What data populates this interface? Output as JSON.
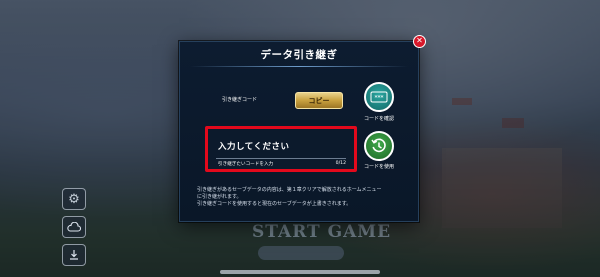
{
  "background": {
    "start_game_label": "START GAME",
    "side_icons": [
      "gear-icon",
      "cloud-icon",
      "download-icon"
    ]
  },
  "modal": {
    "title": "データ引き継ぎ",
    "close_icon": "close-icon",
    "copy_section": {
      "label": "引き継ぎコード",
      "copy_button": "コピー"
    },
    "confirm_code": {
      "icon": "code-display-icon",
      "label": "コードを確認",
      "icon_text": "***"
    },
    "input": {
      "placeholder": "入力してください",
      "hint": "引き継ぎたいコードを入力",
      "counter": "0/12"
    },
    "use_code": {
      "icon": "history-clock-icon",
      "label": "コードを使用"
    },
    "notice": "引き継ぎがあるセーブデータの内容は、第１章クリアで解放されるホームメニューに引き継がれます。",
    "notice_lines": [
      "引き継ぎがあるセーブデータの内容は、第１章クリアで解放されるホームメニュー",
      "に引き継がれます。",
      "引き継ぎコードを使用すると現在のセーブデータが上書きされます。"
    ]
  },
  "colors": {
    "modal_bg": "#0d1c30",
    "highlight_border": "#e3091c",
    "copy_button_gold": "#c9a13f",
    "confirm_teal": "#1e8a86",
    "use_green": "#2f8a3a"
  }
}
